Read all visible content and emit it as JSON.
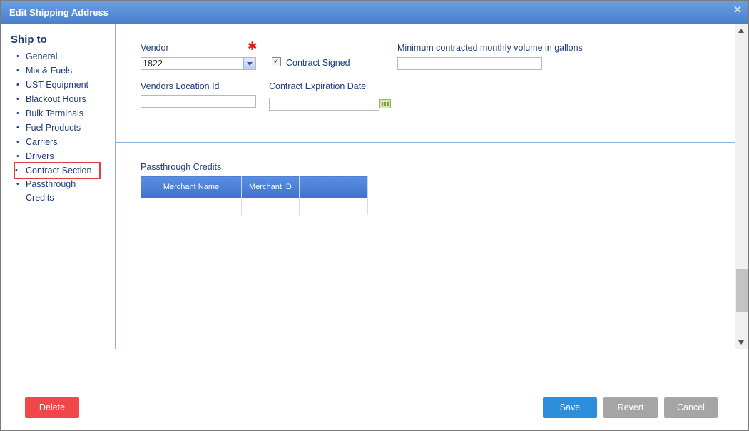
{
  "window": {
    "title": "Edit Shipping Address"
  },
  "sidebar": {
    "heading": "Ship to",
    "items": [
      {
        "label": "General"
      },
      {
        "label": "Mix & Fuels"
      },
      {
        "label": "UST Equipment"
      },
      {
        "label": "Blackout Hours"
      },
      {
        "label": "Bulk Terminals"
      },
      {
        "label": "Fuel Products"
      },
      {
        "label": "Carriers"
      },
      {
        "label": "Drivers"
      },
      {
        "label": "Contract Section"
      },
      {
        "label": "Passthrough Credits"
      }
    ]
  },
  "form": {
    "vendor_label": "Vendor",
    "vendor_value": "1822",
    "contract_signed_label": "Contract Signed",
    "contract_signed_checked": true,
    "min_volume_label": "Minimum contracted monthly volume in gallons",
    "min_volume_value": "",
    "vendor_location_label": "Vendors Location Id",
    "vendor_location_value": "",
    "contract_expiration_label": "Contract Expiration Date",
    "contract_expiration_value": ""
  },
  "passthrough": {
    "title": "Passthrough Credits",
    "columns": [
      "Merchant Name",
      "Merchant ID",
      ""
    ]
  },
  "buttons": {
    "delete": "Delete",
    "save": "Save",
    "revert": "Revert",
    "cancel": "Cancel"
  },
  "colors": {
    "accent": "#2d8fdb",
    "danger": "#f04848",
    "highlight_box": "#e0413a"
  }
}
